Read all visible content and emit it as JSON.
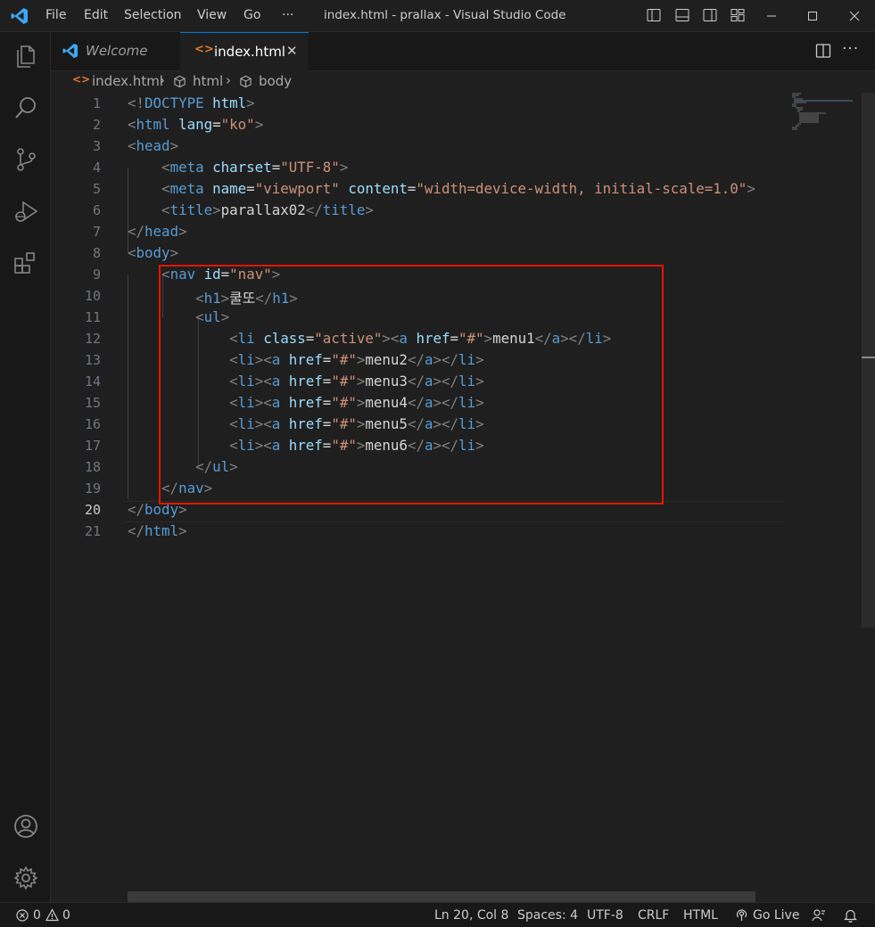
{
  "titlebar": {
    "menus": [
      "File",
      "Edit",
      "Selection",
      "View",
      "Go",
      "···"
    ],
    "title": "index.html - prallax - Visual Studio Code"
  },
  "tabs": [
    {
      "label": "Welcome",
      "icon": "vscode-logo-icon"
    },
    {
      "label": "index.html",
      "icon": "html-file-icon",
      "close": "✕"
    }
  ],
  "breadcrumb": {
    "file": "index.html",
    "items": [
      "html",
      "body"
    ]
  },
  "editor": {
    "current_line": 20,
    "line_numbers": [
      "1",
      "2",
      "3",
      "4",
      "5",
      "6",
      "7",
      "8",
      "9",
      "10",
      "11",
      "12",
      "13",
      "14",
      "15",
      "16",
      "17",
      "18",
      "19",
      "20",
      "21"
    ],
    "highlight_color": "#e51400"
  },
  "statusbar": {
    "errors": "0",
    "warnings": "0",
    "position": "Ln 20, Col 8",
    "spaces": "Spaces: 4",
    "encoding": "UTF-8",
    "eol": "CRLF",
    "language": "HTML",
    "golive": "Go Live"
  },
  "colors": {
    "accent": "#0078d4",
    "tag": "#569cd6",
    "attr": "#9cdcfe",
    "string": "#ce9178"
  }
}
